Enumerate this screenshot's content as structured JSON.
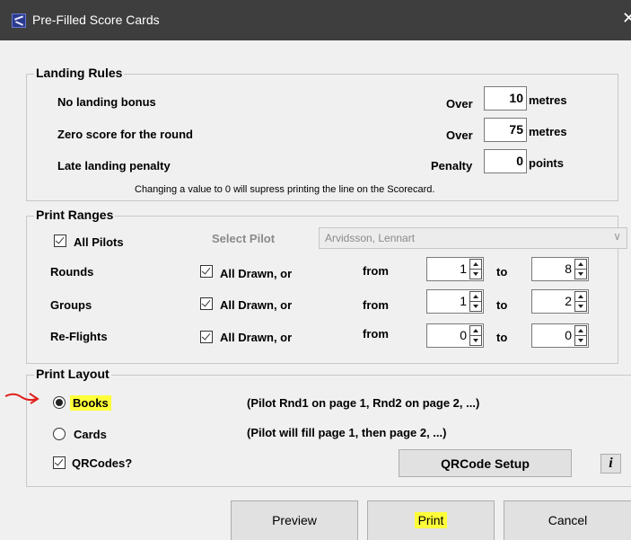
{
  "window": {
    "title": "Pre-Filled Score Cards",
    "close_glyph": "✕"
  },
  "landing_rules": {
    "title": "Landing Rules",
    "rows": [
      {
        "label": "No landing bonus",
        "qualifier": "Over",
        "value": "10",
        "unit": "metres"
      },
      {
        "label": "Zero score for the round",
        "qualifier": "Over",
        "value": "75",
        "unit": "metres"
      },
      {
        "label": "Late landing penalty",
        "qualifier": "Penalty",
        "value": "0",
        "unit": "points"
      }
    ],
    "note": "Changing a value to 0 will supress printing the line on the Scorecard."
  },
  "print_ranges": {
    "title": "Print Ranges",
    "all_pilots_label": "All Pilots",
    "all_pilots_checked": true,
    "select_pilot_label": "Select Pilot",
    "select_pilot_value": "Arvidsson, Lennart",
    "rows": [
      {
        "label": "Rounds",
        "all_drawn_label": "All Drawn, or",
        "checked": true,
        "from_label": "from",
        "from_value": "1",
        "to_label": "to",
        "to_value": "8"
      },
      {
        "label": "Groups",
        "all_drawn_label": "All Drawn, or",
        "checked": true,
        "from_label": "from",
        "from_value": "1",
        "to_label": "to",
        "to_value": "2"
      },
      {
        "label": "Re-Flights",
        "all_drawn_label": "All Drawn, or",
        "checked": true,
        "from_label": "from",
        "from_value": "0",
        "to_label": "to",
        "to_value": "0"
      }
    ]
  },
  "print_layout": {
    "title": "Print Layout",
    "options": [
      {
        "label": "Books",
        "description": "(Pilot Rnd1 on page 1, Rnd2 on page 2, ...)",
        "selected": true
      },
      {
        "label": "Cards",
        "description": "(Pilot will fill page 1,  then page 2, ...)",
        "selected": false
      }
    ],
    "qrcodes_label": "QRCodes?",
    "qrcodes_checked": true,
    "qrcode_setup_label": "QRCode Setup",
    "info_label": "i"
  },
  "buttons": {
    "preview": "Preview",
    "print": "Print",
    "cancel": "Cancel"
  },
  "colors": {
    "highlight": "#ffff3a",
    "annotation_arrow": "#e0201a",
    "titlebar": "#3e3e3e"
  }
}
